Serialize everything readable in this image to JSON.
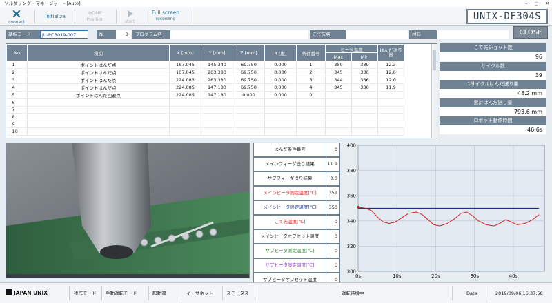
{
  "window": {
    "title": "ソルダリング・マネージャー - [Auto]"
  },
  "toolbar": {
    "connect_label": "connect",
    "initialize_label": "Initialize",
    "home_line1": "HOME",
    "home_line2": "Position",
    "start_label": "start",
    "fullscreen_line1": "Full screen",
    "fullscreen_line2": "recording",
    "model": "UNIX-DF304S"
  },
  "info": {
    "board_code_label": "基板コード",
    "board_code_value": "JU-PCB019-007",
    "no_label": "№",
    "no_value": "3",
    "program_label": "プログラム名",
    "program_value": "",
    "tip_label": "こて先名",
    "tip_value": "",
    "material_label": "材料",
    "material_value": "",
    "close_label": "CLOSE"
  },
  "table": {
    "headers": {
      "no": "No",
      "kind": "種別",
      "x": "X [mm]",
      "y": "Y [mm]",
      "z": "Z [mm]",
      "r": "R [度]",
      "cond": "条件番号",
      "heater": "ヒータ温度",
      "max": "Max",
      "min": "Min",
      "feed": "はんだ送り量"
    },
    "rows": [
      {
        "no": "1",
        "kind": "ポイントはんだ点",
        "x": "167.045",
        "y": "145.340",
        "z": "69.750",
        "r": "0.000",
        "cond": "1",
        "max": "350",
        "min": "339",
        "feed": "12.3"
      },
      {
        "no": "2",
        "kind": "ポイントはんだ点",
        "x": "167.045",
        "y": "263.380",
        "z": "69.750",
        "r": "0.000",
        "cond": "2",
        "max": "345",
        "min": "336",
        "feed": "12.0"
      },
      {
        "no": "3",
        "kind": "ポイントはんだ点",
        "x": "224.085",
        "y": "263.380",
        "z": "69.750",
        "r": "0.000",
        "cond": "3",
        "max": "344",
        "min": "336",
        "feed": "12.0"
      },
      {
        "no": "4",
        "kind": "ポイントはんだ点",
        "x": "224.085",
        "y": "147.180",
        "z": "69.750",
        "r": "0.000",
        "cond": "4",
        "max": "345",
        "min": "336",
        "feed": "11.9"
      },
      {
        "no": "5",
        "kind": "ポイントはんだ回避点",
        "x": "224.085",
        "y": "147.180",
        "z": "0.000",
        "r": "0.000",
        "cond": "0",
        "max": "",
        "min": "",
        "feed": ""
      },
      {
        "no": "6",
        "kind": "",
        "x": "",
        "y": "",
        "z": "",
        "r": "",
        "cond": "",
        "max": "",
        "min": "",
        "feed": ""
      },
      {
        "no": "7",
        "kind": "",
        "x": "",
        "y": "",
        "z": "",
        "r": "",
        "cond": "",
        "max": "",
        "min": "",
        "feed": ""
      },
      {
        "no": "8",
        "kind": "",
        "x": "",
        "y": "",
        "z": "",
        "r": "",
        "cond": "",
        "max": "",
        "min": "",
        "feed": ""
      },
      {
        "no": "9",
        "kind": "",
        "x": "",
        "y": "",
        "z": "",
        "r": "",
        "cond": "",
        "max": "",
        "min": "",
        "feed": ""
      },
      {
        "no": "10",
        "kind": "",
        "x": "",
        "y": "",
        "z": "",
        "r": "",
        "cond": "",
        "max": "",
        "min": "",
        "feed": ""
      }
    ]
  },
  "stats": [
    {
      "label": "こて先ショット数",
      "value": "96"
    },
    {
      "label": "サイクル数",
      "value": "39"
    },
    {
      "label": "1サイクルはんだ送り量",
      "value": "48.2 mm"
    },
    {
      "label": "累計はんだ送り量",
      "value": "793.6 mm"
    },
    {
      "label": "ロボット動作時間",
      "value": "46.6s"
    }
  ],
  "conditions": [
    {
      "label": "はんだ条件番号",
      "value": "0",
      "color": "#111111"
    },
    {
      "label": "メインフィーダ送り結果",
      "value": "11.9",
      "color": "#111111"
    },
    {
      "label": "サブフィーダ送り結果",
      "value": "0.0",
      "color": "#111111"
    },
    {
      "label": "メインヒータ測定温度[℃]",
      "value": "351",
      "color": "#d21c1c"
    },
    {
      "label": "メインヒータ設定温度[℃]",
      "value": "350",
      "color": "#1f3d8a"
    },
    {
      "label": "こて先温度[℃]",
      "value": "0",
      "color": "#d21c1c"
    },
    {
      "label": "メインヒータオフセット温度",
      "value": "0",
      "color": "#111111"
    },
    {
      "label": "サブヒータ測定温度[℃]",
      "value": "0",
      "color": "#2e8b2e"
    },
    {
      "label": "サブヒータ設定温度[℃]",
      "value": "0",
      "color": "#8a2be2"
    },
    {
      "label": "サブヒータオフセット温度",
      "value": "0",
      "color": "#111111"
    }
  ],
  "chart_data": {
    "type": "line",
    "xlabel": "",
    "ylabel": "",
    "xlim": [
      0,
      48
    ],
    "ylim": [
      300,
      400
    ],
    "xticks": [
      "0s",
      "10s",
      "20s",
      "30s",
      "40s"
    ],
    "yticks": [
      "300",
      "320",
      "340",
      "360",
      "380",
      "400"
    ],
    "grid": true,
    "series": [
      {
        "color": "#1f2d7a",
        "x": [
          0,
          46.6
        ],
        "y": [
          350,
          350
        ]
      },
      {
        "color": "#d21c1c",
        "x": [
          0,
          2,
          3.5,
          5,
          6.5,
          8,
          9.5,
          11,
          13,
          15,
          16.5,
          18,
          19.5,
          21,
          23,
          25,
          26.5,
          28,
          29.5,
          31,
          33,
          35,
          36.5,
          38,
          39.5,
          41,
          43,
          45,
          46.6
        ],
        "y": [
          351,
          350,
          348,
          343,
          339,
          338,
          339,
          342,
          346,
          347,
          345,
          341,
          337,
          336,
          338,
          342,
          346,
          347,
          344,
          340,
          337,
          336,
          338,
          341,
          339,
          337,
          338,
          341,
          345
        ]
      }
    ]
  },
  "status": {
    "brand": "JAPAN UNIX",
    "mode": "操作モード",
    "manual": "手動運転モード",
    "source": "起動源",
    "ethernet": "イーサネット",
    "state": "ステータス",
    "message": "運転待機中",
    "date_label": "Date",
    "date_value": "2019/09/06 16:37:58"
  }
}
